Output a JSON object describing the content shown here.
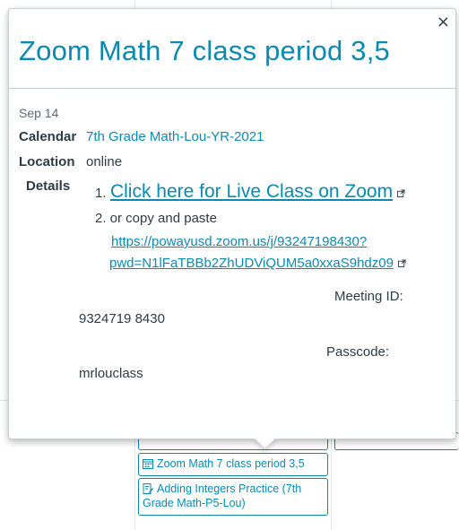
{
  "popover": {
    "title": "Zoom Math 7 class period 3,5",
    "close_label": "×",
    "date": "Sep 14",
    "calendar_label": "Calendar",
    "calendar_value": "7th Grade Math-Lou-YR-2021",
    "location_label": "Location",
    "location_value": "online",
    "details_label": "Details",
    "details": {
      "item1_number": "1.",
      "item1_link": "Click here for Live Class on Zoom",
      "item2_text": "2. or copy and paste",
      "zoom_url_line1": "https://powayusd.zoom.us/j/93247198430?",
      "zoom_url_line2": "pwd=N1lFaTBBb2ZhUDViQUM5a0xxaS9hdz09",
      "meeting_id_label": "Meeting ID:",
      "meeting_id_value": "9324719 8430",
      "passcode_label": "Passcode:",
      "passcode_value": "mrlouclass"
    }
  },
  "calendar_events": [
    {
      "label": "Zoom Math 7 class period 3,5",
      "icon": "calendar-icon"
    },
    {
      "label": "Adding Integers Practice (7th Grade Math-P5-Lou)",
      "icon": "assignment-icon"
    }
  ],
  "colors": {
    "accent": "#0a8ab3",
    "text": "#2d3b45",
    "muted": "#5b6b76",
    "border": "#c7cdd1"
  }
}
